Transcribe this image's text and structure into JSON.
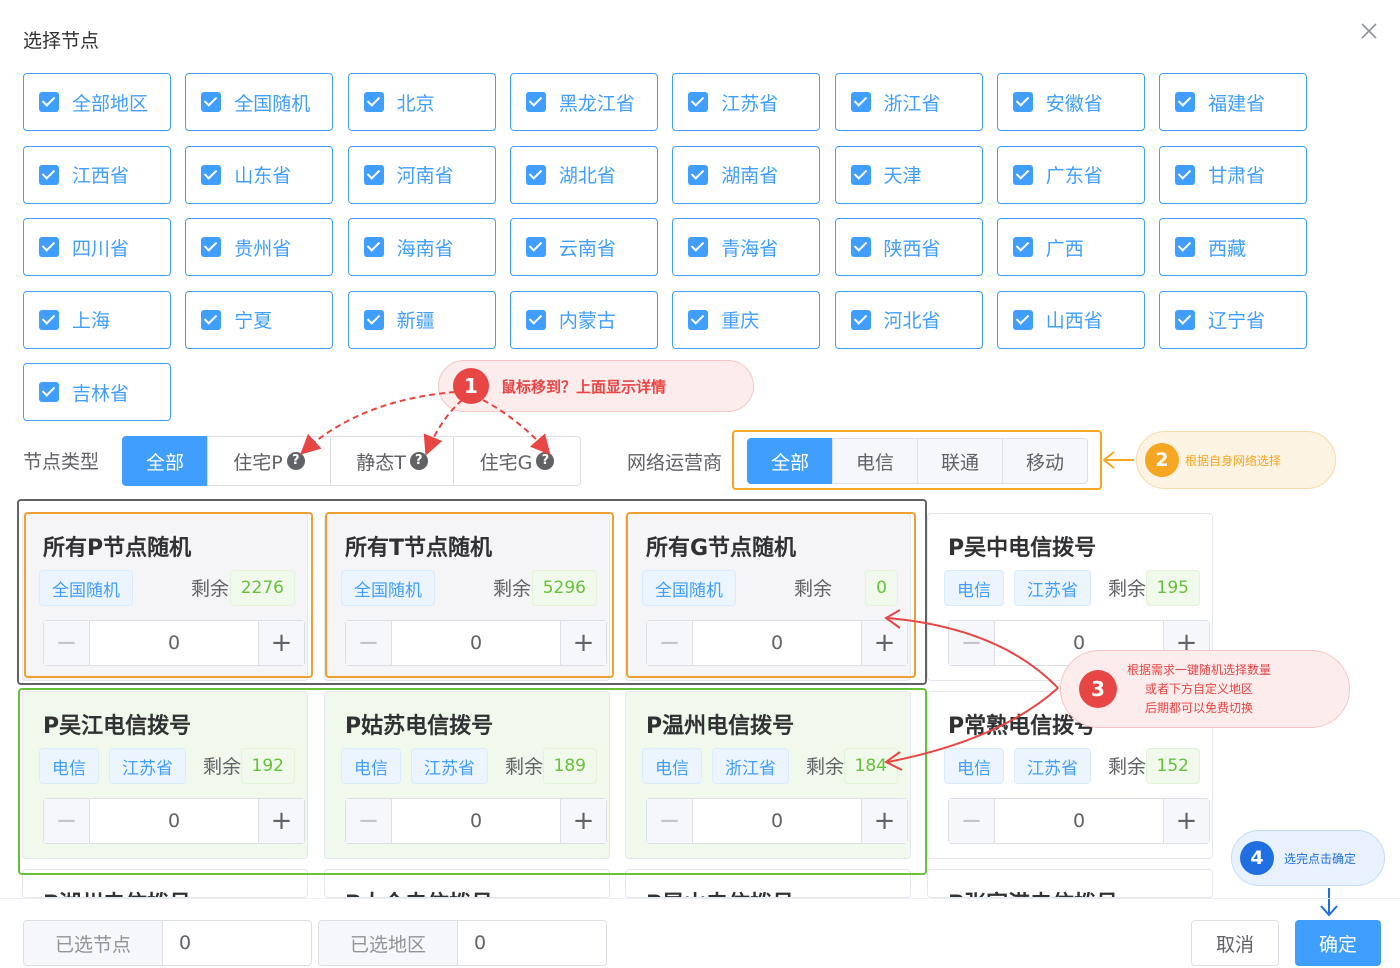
{
  "dialog": {
    "title": "选择节点"
  },
  "regions": [
    "全部地区",
    "全国随机",
    "北京",
    "黑龙江省",
    "江苏省",
    "浙江省",
    "安徽省",
    "福建省",
    "江西省",
    "山东省",
    "河南省",
    "湖北省",
    "湖南省",
    "天津",
    "广东省",
    "甘肃省",
    "四川省",
    "贵州省",
    "海南省",
    "云南省",
    "青海省",
    "陕西省",
    "广西",
    "西藏",
    "上海",
    "宁夏",
    "新疆",
    "内蒙古",
    "重庆",
    "河北省",
    "山西省",
    "辽宁省",
    "吉林省"
  ],
  "filters": {
    "node_type_label": "节点类型",
    "node_types": [
      "全部",
      "住宅P",
      "静态T",
      "住宅G"
    ],
    "node_type_active": "全部",
    "isp_label": "网络运营商",
    "isps": [
      "全部",
      "电信",
      "联通",
      "移动"
    ],
    "isp_active": "全部"
  },
  "cards": [
    {
      "title": "所有P节点随机",
      "tags": [
        "全国随机"
      ],
      "remain_label": "剩余",
      "remain": "2276",
      "qty": "0"
    },
    {
      "title": "所有T节点随机",
      "tags": [
        "全国随机"
      ],
      "remain_label": "剩余",
      "remain": "5296",
      "qty": "0"
    },
    {
      "title": "所有G节点随机",
      "tags": [
        "全国随机"
      ],
      "remain_label": "剩余",
      "remain": "0",
      "qty": "0"
    },
    {
      "title": "P吴中电信拨号",
      "tags": [
        "电信",
        "江苏省"
      ],
      "remain_label": "剩余",
      "remain": "195",
      "qty": "0"
    },
    {
      "title": "P吴江电信拨号",
      "tags": [
        "电信",
        "江苏省"
      ],
      "remain_label": "剩余",
      "remain": "192",
      "qty": "0"
    },
    {
      "title": "P姑苏电信拨号",
      "tags": [
        "电信",
        "江苏省"
      ],
      "remain_label": "剩余",
      "remain": "189",
      "qty": "0"
    },
    {
      "title": "P温州电信拨号",
      "tags": [
        "电信",
        "浙江省"
      ],
      "remain_label": "剩余",
      "remain": "184",
      "qty": "0"
    },
    {
      "title": "P常熟电信拨号",
      "tags": [
        "电信",
        "江苏省"
      ],
      "remain_label": "剩余",
      "remain": "152",
      "qty": "0"
    },
    {
      "title": "P湖州电信拨号",
      "tags": [],
      "remain_label": "",
      "remain": "",
      "qty": ""
    },
    {
      "title": "P太仓电信拨号",
      "tags": [],
      "remain_label": "",
      "remain": "",
      "qty": ""
    },
    {
      "title": "P昆山电信拨号",
      "tags": [],
      "remain_label": "",
      "remain": "",
      "qty": ""
    },
    {
      "title": "P张家港电信拨号",
      "tags": [],
      "remain_label": "",
      "remain": "",
      "qty": ""
    }
  ],
  "stepper": {
    "minus": "−",
    "plus": "+"
  },
  "footer": {
    "selected_nodes_label": "已选节点",
    "selected_nodes_value": "0",
    "selected_regions_label": "已选地区",
    "selected_regions_value": "0",
    "cancel_label": "取消",
    "confirm_label": "确定"
  },
  "annotations": [
    {
      "num": "1",
      "text": "鼠标移到？上面显示详情"
    },
    {
      "num": "2",
      "text": "根据自身网络选择"
    },
    {
      "num": "3",
      "lines": [
        "根据需求一键随机选择数量",
        "或者下方自定义地区",
        "后期都可以免费切换"
      ]
    },
    {
      "num": "4",
      "text": "选完点击确定"
    }
  ],
  "colors": {
    "primary": "#409eff",
    "success": "#67c23a",
    "annotation_red": "#e84545",
    "annotation_orange": "#f5a623",
    "annotation_blue": "#1f6fe0"
  },
  "icons": [
    "close-icon",
    "checkbox-checked-icon",
    "question-icon",
    "arrow-left-icon",
    "arrow-down-icon"
  ]
}
